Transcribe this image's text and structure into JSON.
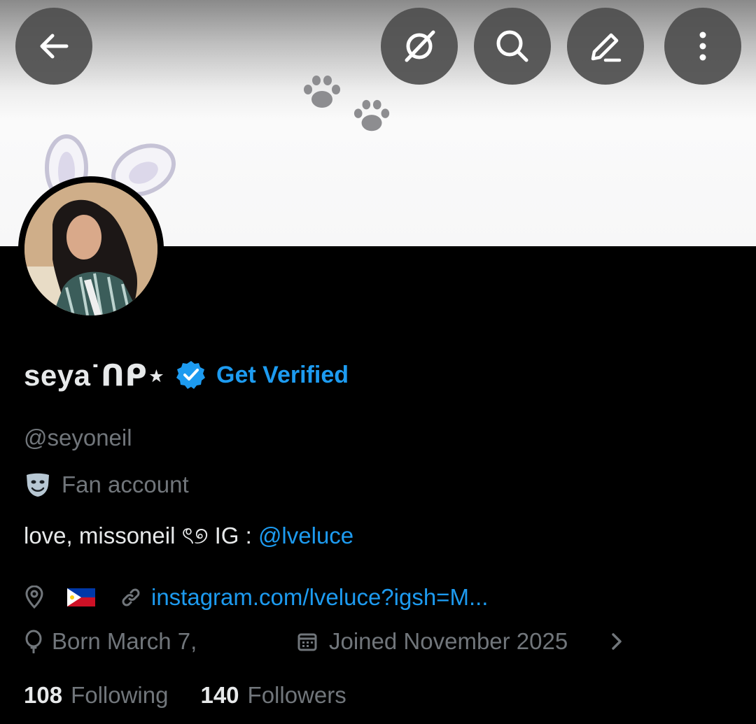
{
  "header": {
    "back_icon": "arrow-left-icon",
    "grok_icon": "grok-icon",
    "search_icon": "search-icon",
    "edit_icon": "pencil-icon",
    "more_icon": "more-vertical-icon"
  },
  "profile": {
    "display_name": "seya˙ᑎᑭ⋆",
    "verified_badge_icon": "verified-badge-icon",
    "get_verified_label": "Get Verified",
    "handle": "@seyoneil",
    "category_icon": "theater-masks-icon",
    "category": "Fan account",
    "bio_text": "love, missoneil ৎ୭ IG : ",
    "bio_mention": "@lveluce",
    "location_icon": "location-pin-icon",
    "location_flag": "philippines-flag",
    "link_icon": "link-icon",
    "website": "instagram.com/lveluce?igsh=M...",
    "birthday_icon": "balloon-icon",
    "birthday": "Born March 7,",
    "joined_icon": "calendar-icon",
    "joined": "Joined November 2025",
    "following_count": "108",
    "following_label": "Following",
    "followers_count": "140",
    "followers_label": "Followers"
  },
  "colors": {
    "accent": "#1d9bf0",
    "secondary_text": "#71767b",
    "primary_text": "#e7e9ea",
    "background": "#000000"
  }
}
